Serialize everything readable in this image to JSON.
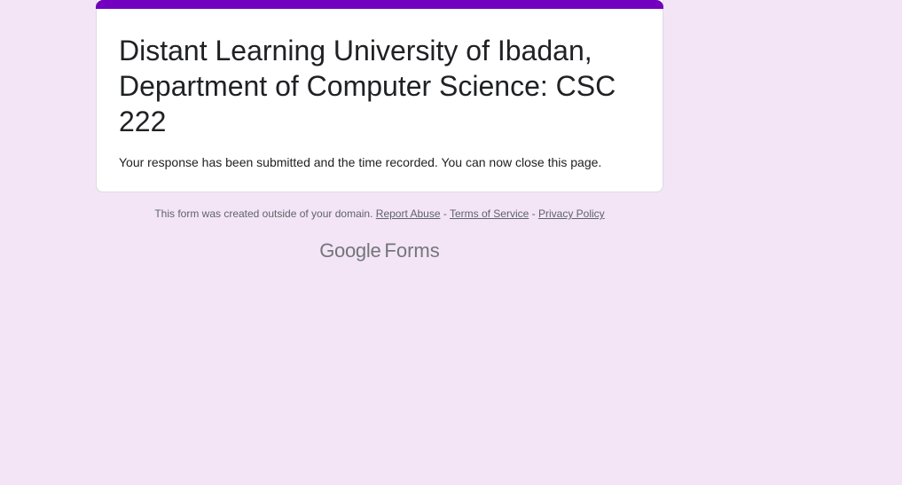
{
  "theme": {
    "accent_color": "#7300bf",
    "background_color": "#f3e5f6"
  },
  "form": {
    "title": "Distant Learning University of Ibadan, Department of Computer Science: CSC 222",
    "confirmation_message": "Your response has been submitted and the time recorded. You can now close this page."
  },
  "footer": {
    "notice": "This form was created outside of your domain.",
    "report_abuse": "Report Abuse",
    "separator": " - ",
    "terms": "Terms of Service",
    "privacy": "Privacy Policy"
  },
  "brand": {
    "google": "Google",
    "forms": "Forms"
  }
}
